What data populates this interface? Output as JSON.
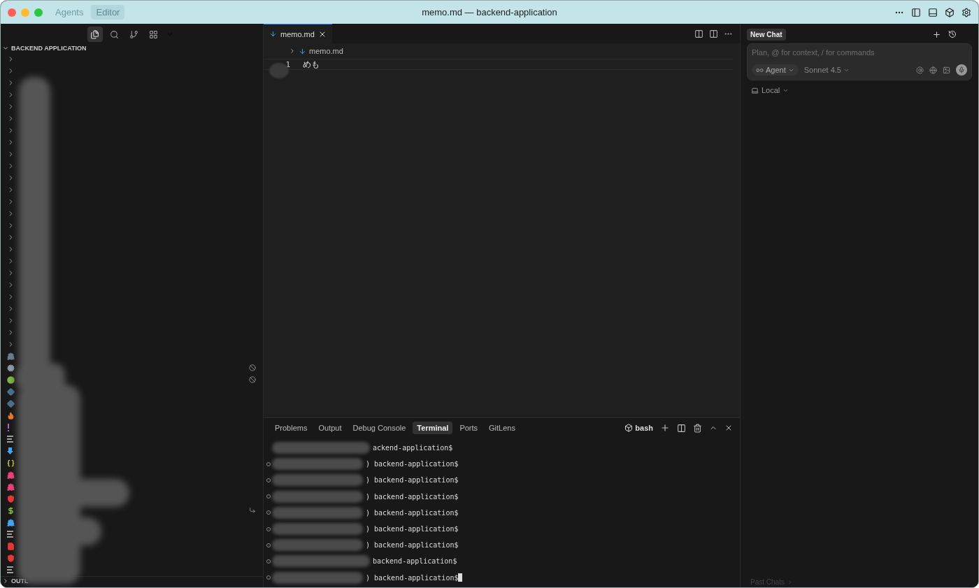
{
  "window": {
    "title": "memo.md — backend-application",
    "modes": [
      {
        "label": "Agents",
        "selected": false
      },
      {
        "label": "Editor",
        "selected": true
      }
    ]
  },
  "sidebar": {
    "views": [
      {
        "kind": "files",
        "selected": true
      },
      {
        "kind": "search",
        "selected": false
      },
      {
        "kind": "git",
        "selected": false
      },
      {
        "kind": "extensions",
        "selected": false
      }
    ],
    "title": "BACKEND APPLICATION",
    "items": [
      {
        "kind": "folder"
      },
      {
        "kind": "folder"
      },
      {
        "kind": "folder"
      },
      {
        "kind": "folder"
      },
      {
        "kind": "folder"
      },
      {
        "kind": "folder"
      },
      {
        "kind": "folder"
      },
      {
        "kind": "folder"
      },
      {
        "kind": "folder"
      },
      {
        "kind": "folder"
      },
      {
        "kind": "folder"
      },
      {
        "kind": "folder"
      },
      {
        "kind": "folder"
      },
      {
        "kind": "folder"
      },
      {
        "kind": "folder"
      },
      {
        "kind": "folder"
      },
      {
        "kind": "folder"
      },
      {
        "kind": "folder"
      },
      {
        "kind": "folder"
      },
      {
        "kind": "folder"
      },
      {
        "kind": "folder"
      },
      {
        "kind": "folder"
      },
      {
        "kind": "folder"
      },
      {
        "kind": "folder"
      },
      {
        "kind": "folder"
      },
      {
        "kind": "whale",
        "color": "#6f7a83"
      },
      {
        "kind": "gear",
        "color": "#8a9aa8",
        "badge": {
          "kind": "ignored"
        }
      },
      {
        "kind": "dot",
        "color": "#7cb342",
        "badge": {
          "kind": "ignored"
        }
      },
      {
        "kind": "diamond",
        "color": "#4a6f8a"
      },
      {
        "kind": "diamond",
        "color": "#4a6f8a"
      },
      {
        "kind": "flame",
        "color": "#e8772e"
      },
      {
        "kind": "bang",
        "color": "#a463d6"
      },
      {
        "kind": "lines",
        "color": "#a0a0a0"
      },
      {
        "kind": "arrow",
        "color": "#42a5f5"
      },
      {
        "kind": "braces",
        "color": "#cbcb41"
      },
      {
        "kind": "whale",
        "color": "#ec407a"
      },
      {
        "kind": "whale",
        "color": "#ec407a"
      },
      {
        "kind": "shield",
        "color": "#e53935"
      },
      {
        "kind": "dollar",
        "color": "#8bc34a",
        "badge": {
          "kind": "link"
        }
      },
      {
        "kind": "whale",
        "color": "#42a5f5"
      },
      {
        "kind": "lines",
        "color": "#a0a0a0"
      },
      {
        "kind": "pdf",
        "color": "#e53935"
      },
      {
        "kind": "shield",
        "color": "#e53935"
      },
      {
        "kind": "lines",
        "color": "#a0a0a0"
      }
    ],
    "outline": "OUTL"
  },
  "editor": {
    "tab": "memo.md",
    "breadcrumb": "memo.md",
    "lines": [
      {
        "number": "1",
        "text": "めも"
      }
    ]
  },
  "panel": {
    "tabs": [
      {
        "label": "Problems",
        "selected": false
      },
      {
        "label": "Output",
        "selected": false
      },
      {
        "label": "Debug Console",
        "selected": false
      },
      {
        "label": "Terminal",
        "selected": true
      },
      {
        "label": "Ports",
        "selected": false
      },
      {
        "label": "GitLens",
        "selected": false
      }
    ],
    "shell": "bash",
    "lines": [
      {
        "prompt": "ackend-application$",
        "marker": false,
        "cursor": false
      },
      {
        "prompt": ") backend-application$",
        "marker": true,
        "cursor": false
      },
      {
        "prompt": ") backend-application$",
        "marker": true,
        "cursor": false
      },
      {
        "prompt": ") backend-application$",
        "marker": true,
        "cursor": false
      },
      {
        "prompt": ") backend-application$",
        "marker": true,
        "cursor": false
      },
      {
        "prompt": ") backend-application$",
        "marker": true,
        "cursor": false
      },
      {
        "prompt": ") backend-application$",
        "marker": true,
        "cursor": false
      },
      {
        "prompt": "backend-application$",
        "marker": true,
        "cursor": false
      },
      {
        "prompt": ") backend-application$",
        "marker": true,
        "cursor": true
      }
    ]
  },
  "chat": {
    "tab": "New Chat",
    "placeholder": "Plan, @ for context, / for commands",
    "mode": "Agent",
    "model": "Sonnet 4.5",
    "location": "Local",
    "past": "Past Chats"
  }
}
